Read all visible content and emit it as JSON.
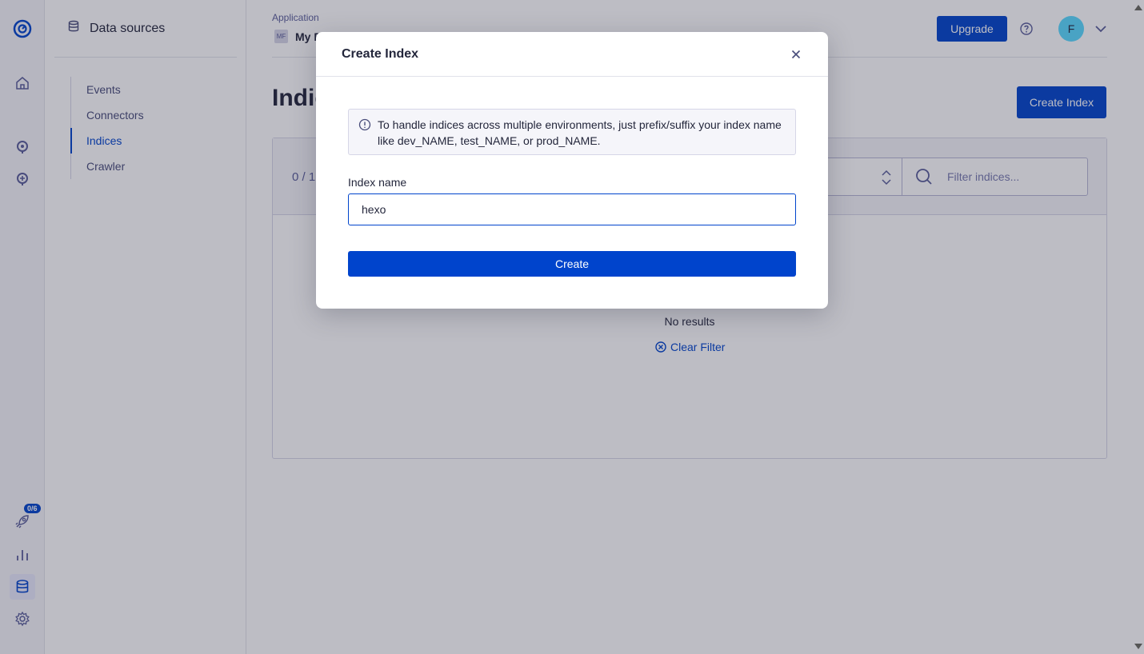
{
  "sidebar": {
    "title": "Data sources",
    "items": [
      {
        "label": "Events"
      },
      {
        "label": "Connectors"
      },
      {
        "label": "Indices"
      },
      {
        "label": "Crawler"
      }
    ]
  },
  "rail": {
    "onboarding_badge": "0/6",
    "icons": [
      "algolia-logo",
      "home-icon",
      "search-icon",
      "discovery-icon",
      "rocket-icon",
      "analytics-icon",
      "database-icon",
      "gear-icon"
    ]
  },
  "header": {
    "app_label": "Application",
    "app_badge": "MF",
    "app_name": "My F",
    "upgrade_label": "Upgrade",
    "avatar_initial": "F"
  },
  "main": {
    "page_title": "Indic",
    "create_index_label": "Create Index",
    "count_text": "0 / 1",
    "filter_placeholder": "Filter indices...",
    "no_results": "No results",
    "clear_filter": "Clear Filter"
  },
  "modal": {
    "title": "Create Index",
    "info_text": "To handle indices across multiple environments, just prefix/suffix your index name like dev_NAME, test_NAME, or prod_NAME.",
    "field_label": "Index name",
    "field_value": "hexo",
    "create_label": "Create"
  },
  "colors": {
    "accent": "#0044cc",
    "avatar": "#5adaff",
    "overlay": "rgba(35,38,59,0.3)"
  }
}
